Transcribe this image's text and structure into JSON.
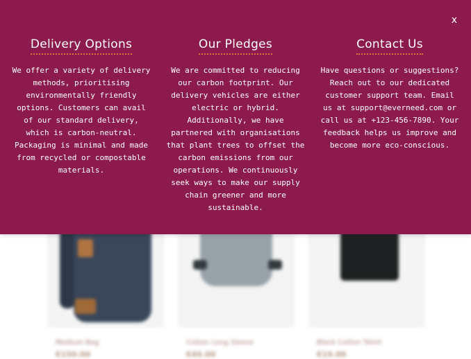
{
  "overlay": {
    "close_label": "x",
    "accent_color": "#e0733c",
    "background_color": "#8c1a4c",
    "sections": [
      {
        "title": "Delivery Options",
        "body": "We offer a variety of delivery methods, prioritising environmentally friendly options. Customers can avail of our standard delivery, which is carbon-neutral. Packaging is minimal and made from recycled or compostable materials."
      },
      {
        "title": "Our Pledges",
        "body": "We are committed to reducing our carbon footprint. Our delivery vehicles are either electric or hybrid. Additionally, we have partnered with organisations that plant trees to offset the carbon emissions from our operations. We continuously seek ways to make our supply chain greener and more sustainable."
      },
      {
        "title": "Contact Us",
        "body": "Have questions or suggestions? Reach out to our dedicated customer support team. Email us at support@everneed.com or call us at +123-456-7890. Your feedback helps us improve and become more eco-conscious."
      }
    ]
  },
  "products": [
    {
      "name": "Medium Bag",
      "price": "€150.00",
      "icon": "backpack-image"
    },
    {
      "name": "Cotton Long Sleeve",
      "price": "€49.00",
      "icon": "sweater-image"
    },
    {
      "name": "Black Cotton Tshirt",
      "price": "€19.00",
      "icon": "tshirt-image"
    }
  ]
}
